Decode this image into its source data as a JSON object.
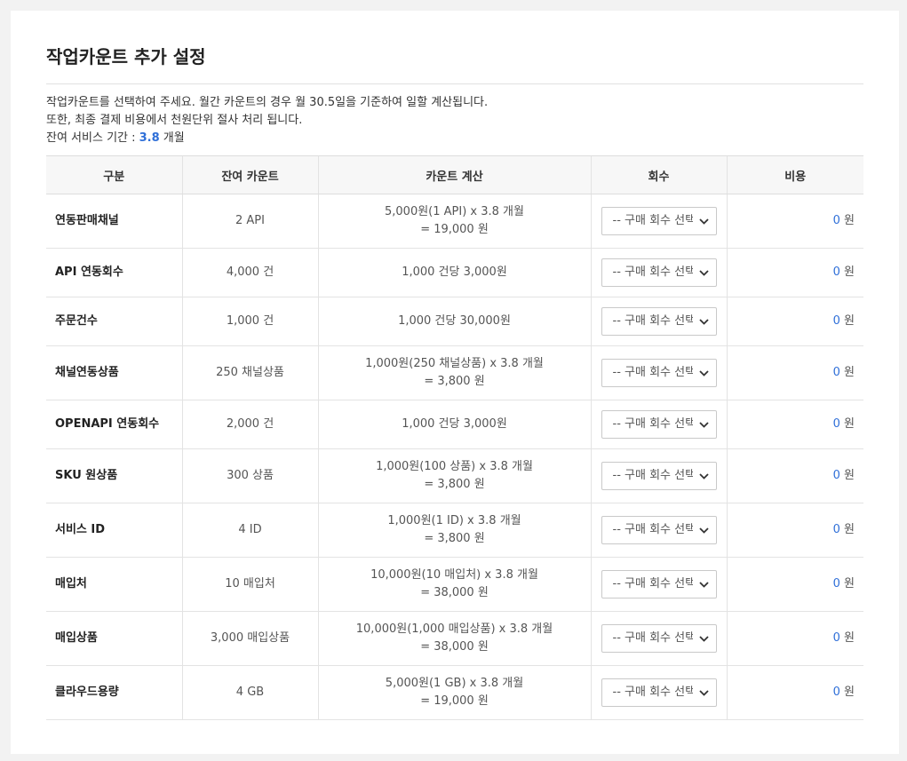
{
  "page": {
    "title": "작업카운트 추가 설정",
    "desc_line1": "작업카운트를 선택하여 주세요. 월간 카운트의 경우 월 30.5일을 기준하여 일할 계산됩니다.",
    "desc_line2": "또한, 최종 결제 비용에서 천원단위 절사 처리 됩니다.",
    "period_label": "잔여 서비스 기간 : ",
    "period_value": "3.8",
    "period_unit": " 개월"
  },
  "table": {
    "headers": [
      "구분",
      "잔여 카운트",
      "카운트 계산",
      "회수",
      "비용"
    ],
    "select_placeholder": "-- 구매 회수 선택 --",
    "currency": " 원",
    "rows": [
      {
        "name": "연동판매채널",
        "remaining": "2 API",
        "calc1": "5,000원(1 API) x 3.8 개월",
        "calc2": "= 19,000 원",
        "cost": "0"
      },
      {
        "name": "API 연동회수",
        "remaining": "4,000 건",
        "calc1": "1,000 건당 3,000원",
        "calc2": "",
        "cost": "0"
      },
      {
        "name": "주문건수",
        "remaining": "1,000 건",
        "calc1": "1,000 건당 30,000원",
        "calc2": "",
        "cost": "0"
      },
      {
        "name": "채널연동상품",
        "remaining": "250 채널상품",
        "calc1": "1,000원(250 채널상품) x 3.8 개월",
        "calc2": "= 3,800 원",
        "cost": "0"
      },
      {
        "name": "OPENAPI 연동회수",
        "remaining": "2,000 건",
        "calc1": "1,000 건당 3,000원",
        "calc2": "",
        "cost": "0"
      },
      {
        "name": "SKU 원상품",
        "remaining": "300 상품",
        "calc1": "1,000원(100 상품) x 3.8 개월",
        "calc2": "= 3,800 원",
        "cost": "0"
      },
      {
        "name": "서비스 ID",
        "remaining": "4 ID",
        "calc1": "1,000원(1 ID) x 3.8 개월",
        "calc2": "= 3,800 원",
        "cost": "0"
      },
      {
        "name": "매입처",
        "remaining": "10 매입처",
        "calc1": "10,000원(10 매입처) x 3.8 개월",
        "calc2": "= 38,000 원",
        "cost": "0"
      },
      {
        "name": "매입상품",
        "remaining": "3,000 매입상품",
        "calc1": "10,000원(1,000 매입상품) x 3.8 개월",
        "calc2": "= 38,000 원",
        "cost": "0"
      },
      {
        "name": "클라우드용량",
        "remaining": "4 GB",
        "calc1": "5,000원(1 GB) x 3.8 개월",
        "calc2": "= 19,000 원",
        "cost": "0"
      }
    ]
  },
  "colors": {
    "accent": "#2f6fd8",
    "header_bg": "#f7f7f7"
  }
}
